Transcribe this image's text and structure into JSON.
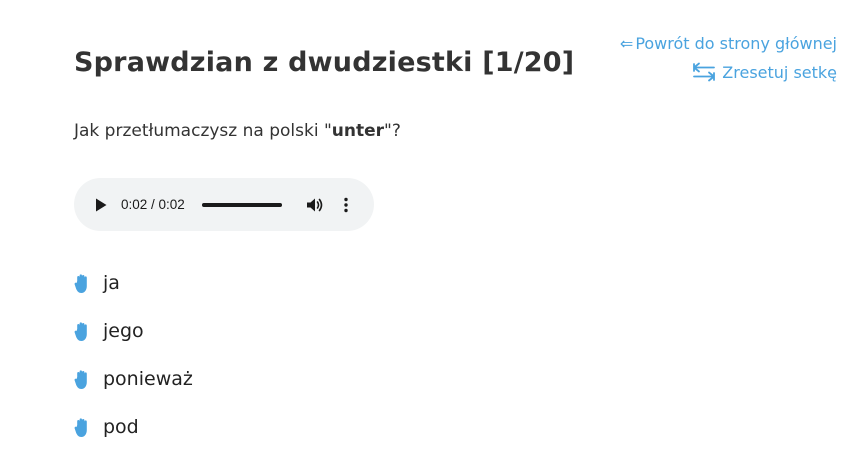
{
  "nav": {
    "back_label": "Powrót do strony głównej",
    "back_icon": "⇐",
    "reset_label": "Zresetuj setkę"
  },
  "page": {
    "title": "Sprawdzian z dwudziestki [1/20]"
  },
  "question": {
    "prefix": "Jak przetłumaczysz na polski \"",
    "word": "unter",
    "suffix": "\"?"
  },
  "audio": {
    "time": "0:02 / 0:02",
    "progress_fraction": 1.0
  },
  "answers": [
    {
      "label": "ja"
    },
    {
      "label": "jego"
    },
    {
      "label": "ponieważ"
    },
    {
      "label": "pod"
    }
  ],
  "colors": {
    "accent": "#4aa3df",
    "audio_bg": "#f1f3f4"
  }
}
